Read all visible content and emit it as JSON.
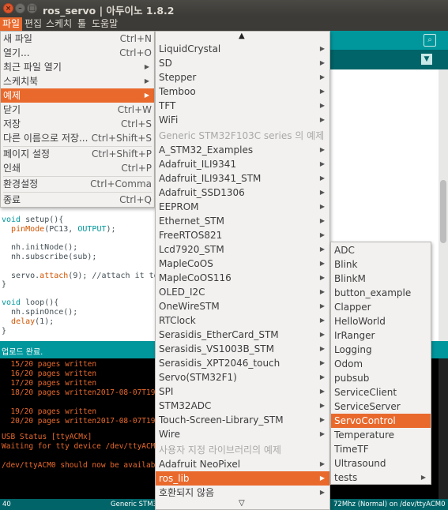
{
  "window": {
    "title": "ros_servo | 아두이노 1.8.2"
  },
  "menubar": [
    {
      "label": "파일",
      "active": true
    },
    {
      "label": "편집"
    },
    {
      "label": "스케치"
    },
    {
      "label": "툴"
    },
    {
      "label": "도움말"
    }
  ],
  "file_menu": [
    {
      "label": "새 파일",
      "shortcut": "Ctrl+N"
    },
    {
      "label": "열기...",
      "shortcut": "Ctrl+O"
    },
    {
      "label": "최근 파일 열기",
      "submenu": true
    },
    {
      "label": "스케치북",
      "submenu": true
    },
    {
      "label": "예제",
      "submenu": true,
      "active": true
    },
    {
      "label": "닫기",
      "shortcut": "Ctrl+W"
    },
    {
      "label": "저장",
      "shortcut": "Ctrl+S"
    },
    {
      "label": "다른 이름으로 저장...",
      "shortcut": "Ctrl+Shift+S"
    },
    {
      "label": "페이지 설정",
      "shortcut": "Ctrl+Shift+P"
    },
    {
      "label": "인쇄",
      "shortcut": "Ctrl+P"
    },
    {
      "label": "환경설정",
      "shortcut": "Ctrl+Comma"
    },
    {
      "label": "종료",
      "shortcut": "Ctrl+Q"
    }
  ],
  "examples_menu": {
    "scroll_up": "▲",
    "scroll_down": "▽",
    "items": [
      {
        "label": "LiquidCrystal",
        "submenu": true
      },
      {
        "label": "SD",
        "submenu": true
      },
      {
        "label": "Stepper",
        "submenu": true
      },
      {
        "label": "Temboo",
        "submenu": true
      },
      {
        "label": "TFT",
        "submenu": true
      },
      {
        "label": "WiFi",
        "submenu": true
      },
      {
        "label": "Generic STM32F103C series 의 예제",
        "disabled": true
      },
      {
        "label": "A_STM32_Examples",
        "submenu": true
      },
      {
        "label": "Adafruit_ILI9341",
        "submenu": true
      },
      {
        "label": "Adafruit_ILI9341_STM",
        "submenu": true
      },
      {
        "label": "Adafruit_SSD1306",
        "submenu": true
      },
      {
        "label": "EEPROM",
        "submenu": true
      },
      {
        "label": "Ethernet_STM",
        "submenu": true
      },
      {
        "label": "FreeRTOS821",
        "submenu": true
      },
      {
        "label": "Lcd7920_STM",
        "submenu": true
      },
      {
        "label": "MapleCoOS",
        "submenu": true
      },
      {
        "label": "MapleCoOS116",
        "submenu": true
      },
      {
        "label": "OLED_I2C",
        "submenu": true
      },
      {
        "label": "OneWireSTM",
        "submenu": true
      },
      {
        "label": "RTClock",
        "submenu": true
      },
      {
        "label": "Serasidis_EtherCard_STM",
        "submenu": true
      },
      {
        "label": "Serasidis_VS1003B_STM",
        "submenu": true
      },
      {
        "label": "Serasidis_XPT2046_touch",
        "submenu": true
      },
      {
        "label": "Servo(STM32F1)",
        "submenu": true
      },
      {
        "label": "SPI",
        "submenu": true
      },
      {
        "label": "STM32ADC",
        "submenu": true
      },
      {
        "label": "Touch-Screen-Library_STM",
        "submenu": true
      },
      {
        "label": "Wire",
        "submenu": true
      },
      {
        "label": "사용자 지정 라이브러리의 예제",
        "disabled": true
      },
      {
        "label": "Adafruit NeoPixel",
        "submenu": true
      },
      {
        "label": "ros_lib",
        "submenu": true,
        "active": true
      },
      {
        "label": "호환되지 않음",
        "submenu": true
      }
    ]
  },
  "ros_lib_menu": [
    {
      "label": "ADC"
    },
    {
      "label": "Blink"
    },
    {
      "label": "BlinkM"
    },
    {
      "label": "button_example"
    },
    {
      "label": "Clapper"
    },
    {
      "label": "HelloWorld"
    },
    {
      "label": "IrRanger"
    },
    {
      "label": "Logging"
    },
    {
      "label": "Odom"
    },
    {
      "label": "pubsub"
    },
    {
      "label": "ServiceClient"
    },
    {
      "label": "ServiceServer"
    },
    {
      "label": "ServoControl",
      "active": true
    },
    {
      "label": "Temperature"
    },
    {
      "label": "TimeTF"
    },
    {
      "label": "Ultrasound"
    },
    {
      "label": "tests",
      "submenu": true
    }
  ],
  "editor": {
    "lines": {
      "l1_a": "void",
      "l1_b": " setup(){",
      "l2_a": "  ",
      "l2_b": "pinMode",
      "l2_c": "(PC13, ",
      "l2_d": "OUTPUT",
      "l2_e": ");",
      "l3": "  nh.initNode();",
      "l4": "  nh.subscribe(sub);",
      "l5_a": "  servo.",
      "l5_b": "attach",
      "l5_c": "(9); //attach it to pi",
      "l6": "}",
      "l7_a": "void",
      "l7_b": " loop(){",
      "l8": "  nh.spinOnce();",
      "l9_a": "  ",
      "l9_b": "delay",
      "l9_c": "(1);",
      "l10": "}"
    }
  },
  "status": {
    "text": "업로드 완료."
  },
  "console": {
    "lines": [
      "  15/20 pages written",
      "  16/20 pages written",
      "  17/20 pages written",
      "  18/20 pages written2017-08-07T19:52",
      "",
      "  19/20 pages written",
      "  20/20 pages written2017-08-07T19:52",
      "",
      "USB Status [ttyACMx]",
      "Waiting for tty device /dev/ttyACM0",
      "",
      "/dev/ttyACM0 should now be available"
    ]
  },
  "bottombar": {
    "line": "40",
    "board": "Generic STM32",
    "port": "72Mhz (Normal) on /dev/ttyACM0"
  },
  "colors": {
    "accent": "#e9692c",
    "teal": "#00979c",
    "dark_teal": "#006468",
    "menu_bg": "#f2f1f0",
    "titlebar": "#3c3b37"
  }
}
